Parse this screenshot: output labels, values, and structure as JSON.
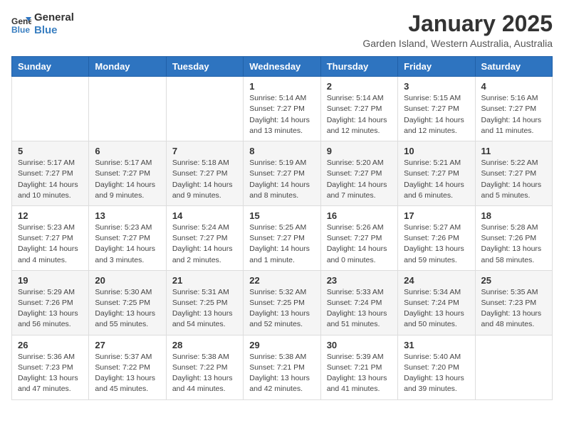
{
  "logo": {
    "general": "General",
    "blue": "Blue"
  },
  "title": "January 2025",
  "subtitle": "Garden Island, Western Australia, Australia",
  "headers": [
    "Sunday",
    "Monday",
    "Tuesday",
    "Wednesday",
    "Thursday",
    "Friday",
    "Saturday"
  ],
  "weeks": [
    [
      {
        "day": "",
        "info": ""
      },
      {
        "day": "",
        "info": ""
      },
      {
        "day": "",
        "info": ""
      },
      {
        "day": "1",
        "info": "Sunrise: 5:14 AM\nSunset: 7:27 PM\nDaylight: 14 hours\nand 13 minutes."
      },
      {
        "day": "2",
        "info": "Sunrise: 5:14 AM\nSunset: 7:27 PM\nDaylight: 14 hours\nand 12 minutes."
      },
      {
        "day": "3",
        "info": "Sunrise: 5:15 AM\nSunset: 7:27 PM\nDaylight: 14 hours\nand 12 minutes."
      },
      {
        "day": "4",
        "info": "Sunrise: 5:16 AM\nSunset: 7:27 PM\nDaylight: 14 hours\nand 11 minutes."
      }
    ],
    [
      {
        "day": "5",
        "info": "Sunrise: 5:17 AM\nSunset: 7:27 PM\nDaylight: 14 hours\nand 10 minutes."
      },
      {
        "day": "6",
        "info": "Sunrise: 5:17 AM\nSunset: 7:27 PM\nDaylight: 14 hours\nand 9 minutes."
      },
      {
        "day": "7",
        "info": "Sunrise: 5:18 AM\nSunset: 7:27 PM\nDaylight: 14 hours\nand 9 minutes."
      },
      {
        "day": "8",
        "info": "Sunrise: 5:19 AM\nSunset: 7:27 PM\nDaylight: 14 hours\nand 8 minutes."
      },
      {
        "day": "9",
        "info": "Sunrise: 5:20 AM\nSunset: 7:27 PM\nDaylight: 14 hours\nand 7 minutes."
      },
      {
        "day": "10",
        "info": "Sunrise: 5:21 AM\nSunset: 7:27 PM\nDaylight: 14 hours\nand 6 minutes."
      },
      {
        "day": "11",
        "info": "Sunrise: 5:22 AM\nSunset: 7:27 PM\nDaylight: 14 hours\nand 5 minutes."
      }
    ],
    [
      {
        "day": "12",
        "info": "Sunrise: 5:23 AM\nSunset: 7:27 PM\nDaylight: 14 hours\nand 4 minutes."
      },
      {
        "day": "13",
        "info": "Sunrise: 5:23 AM\nSunset: 7:27 PM\nDaylight: 14 hours\nand 3 minutes."
      },
      {
        "day": "14",
        "info": "Sunrise: 5:24 AM\nSunset: 7:27 PM\nDaylight: 14 hours\nand 2 minutes."
      },
      {
        "day": "15",
        "info": "Sunrise: 5:25 AM\nSunset: 7:27 PM\nDaylight: 14 hours\nand 1 minute."
      },
      {
        "day": "16",
        "info": "Sunrise: 5:26 AM\nSunset: 7:27 PM\nDaylight: 14 hours\nand 0 minutes."
      },
      {
        "day": "17",
        "info": "Sunrise: 5:27 AM\nSunset: 7:26 PM\nDaylight: 13 hours\nand 59 minutes."
      },
      {
        "day": "18",
        "info": "Sunrise: 5:28 AM\nSunset: 7:26 PM\nDaylight: 13 hours\nand 58 minutes."
      }
    ],
    [
      {
        "day": "19",
        "info": "Sunrise: 5:29 AM\nSunset: 7:26 PM\nDaylight: 13 hours\nand 56 minutes."
      },
      {
        "day": "20",
        "info": "Sunrise: 5:30 AM\nSunset: 7:25 PM\nDaylight: 13 hours\nand 55 minutes."
      },
      {
        "day": "21",
        "info": "Sunrise: 5:31 AM\nSunset: 7:25 PM\nDaylight: 13 hours\nand 54 minutes."
      },
      {
        "day": "22",
        "info": "Sunrise: 5:32 AM\nSunset: 7:25 PM\nDaylight: 13 hours\nand 52 minutes."
      },
      {
        "day": "23",
        "info": "Sunrise: 5:33 AM\nSunset: 7:24 PM\nDaylight: 13 hours\nand 51 minutes."
      },
      {
        "day": "24",
        "info": "Sunrise: 5:34 AM\nSunset: 7:24 PM\nDaylight: 13 hours\nand 50 minutes."
      },
      {
        "day": "25",
        "info": "Sunrise: 5:35 AM\nSunset: 7:23 PM\nDaylight: 13 hours\nand 48 minutes."
      }
    ],
    [
      {
        "day": "26",
        "info": "Sunrise: 5:36 AM\nSunset: 7:23 PM\nDaylight: 13 hours\nand 47 minutes."
      },
      {
        "day": "27",
        "info": "Sunrise: 5:37 AM\nSunset: 7:22 PM\nDaylight: 13 hours\nand 45 minutes."
      },
      {
        "day": "28",
        "info": "Sunrise: 5:38 AM\nSunset: 7:22 PM\nDaylight: 13 hours\nand 44 minutes."
      },
      {
        "day": "29",
        "info": "Sunrise: 5:38 AM\nSunset: 7:21 PM\nDaylight: 13 hours\nand 42 minutes."
      },
      {
        "day": "30",
        "info": "Sunrise: 5:39 AM\nSunset: 7:21 PM\nDaylight: 13 hours\nand 41 minutes."
      },
      {
        "day": "31",
        "info": "Sunrise: 5:40 AM\nSunset: 7:20 PM\nDaylight: 13 hours\nand 39 minutes."
      },
      {
        "day": "",
        "info": ""
      }
    ]
  ]
}
